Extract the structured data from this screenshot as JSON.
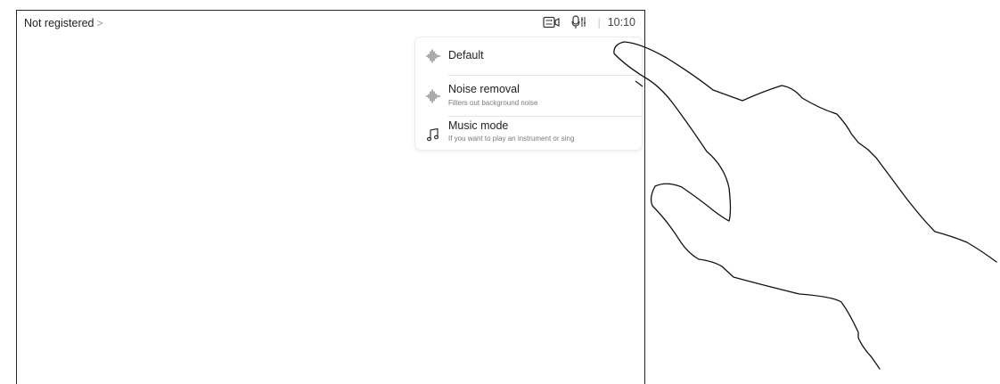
{
  "status_bar": {
    "registration_text": "Not registered",
    "registration_chevron": ">",
    "time": "10:10",
    "separator": "|",
    "icons": [
      "self-view-icon",
      "microphone-settings-icon"
    ]
  },
  "audio_menu": {
    "items": [
      {
        "icon": "waveform-icon",
        "title": "Default",
        "subtitle": ""
      },
      {
        "icon": "waveform-icon",
        "title": "Noise removal",
        "subtitle": "Filters out background noise"
      },
      {
        "icon": "music-note-icon",
        "title": "Music mode",
        "subtitle": "If you want to play an instrument or sing"
      }
    ]
  },
  "illustration": {
    "subject": "pointing-hand-outline"
  },
  "colors": {
    "frame": "#262626",
    "text": "#1f1f1f",
    "subtle_text": "#7a7a7a",
    "divider": "#e4e4e4"
  }
}
